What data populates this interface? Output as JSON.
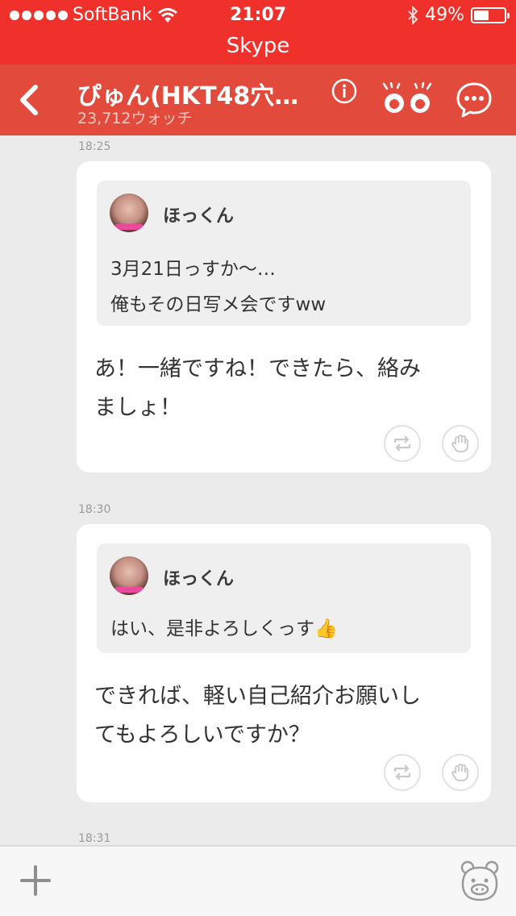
{
  "status_bar": {
    "carrier": "SoftBank",
    "time": "21:07",
    "battery_percent": "49%",
    "battery_level": 0.49,
    "app_name": "Skype"
  },
  "header": {
    "title": "ぴゅん(HKT48穴…",
    "subtitle": "23,712ウォッチ",
    "icons": [
      "back-icon",
      "info-icon",
      "watch-eyes-icon",
      "chat-bubble-icon"
    ]
  },
  "messages": [
    {
      "time": "18:25",
      "quote_name": "ほっくん",
      "quote_text": "3月21日っすか〜…\n俺もその日写メ会ですww",
      "text": "あ！一緒ですね！できたら、絡み\nましょ！"
    },
    {
      "time": "18:30",
      "quote_name": "ほっくん",
      "quote_text": "はい、是非よろしくっす👍",
      "text": "できれば、軽い自己紹介お願いし\nてもよろしいですか？"
    },
    {
      "time": "18:31"
    }
  ],
  "bottom_bar": {
    "icons": [
      "plus-icon",
      "bear-face-icon"
    ]
  }
}
